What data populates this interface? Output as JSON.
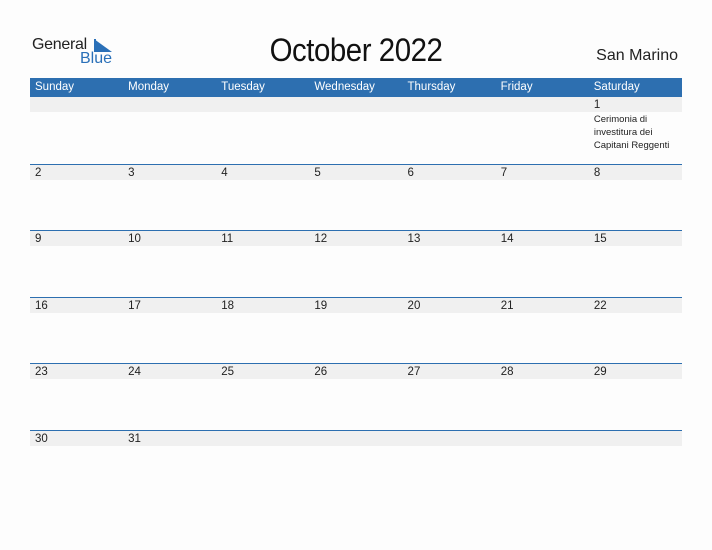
{
  "logo": {
    "word1": "General",
    "word2": "Blue"
  },
  "title": "October 2022",
  "country": "San Marino",
  "colors": {
    "accent": "#2d6fb0",
    "band": "#f0f0f0"
  },
  "weekdays": [
    "Sunday",
    "Monday",
    "Tuesday",
    "Wednesday",
    "Thursday",
    "Friday",
    "Saturday"
  ],
  "weeks": [
    [
      {
        "d": ""
      },
      {
        "d": ""
      },
      {
        "d": ""
      },
      {
        "d": ""
      },
      {
        "d": ""
      },
      {
        "d": ""
      },
      {
        "d": "1",
        "event": "Cerimonia di investitura dei Capitani Reggenti"
      }
    ],
    [
      {
        "d": "2"
      },
      {
        "d": "3"
      },
      {
        "d": "4"
      },
      {
        "d": "5"
      },
      {
        "d": "6"
      },
      {
        "d": "7"
      },
      {
        "d": "8"
      }
    ],
    [
      {
        "d": "9"
      },
      {
        "d": "10"
      },
      {
        "d": "11"
      },
      {
        "d": "12"
      },
      {
        "d": "13"
      },
      {
        "d": "14"
      },
      {
        "d": "15"
      }
    ],
    [
      {
        "d": "16"
      },
      {
        "d": "17"
      },
      {
        "d": "18"
      },
      {
        "d": "19"
      },
      {
        "d": "20"
      },
      {
        "d": "21"
      },
      {
        "d": "22"
      }
    ],
    [
      {
        "d": "23"
      },
      {
        "d": "24"
      },
      {
        "d": "25"
      },
      {
        "d": "26"
      },
      {
        "d": "27"
      },
      {
        "d": "28"
      },
      {
        "d": "29"
      }
    ],
    [
      {
        "d": "30"
      },
      {
        "d": "31"
      },
      {
        "d": ""
      },
      {
        "d": ""
      },
      {
        "d": ""
      },
      {
        "d": ""
      },
      {
        "d": ""
      }
    ]
  ]
}
